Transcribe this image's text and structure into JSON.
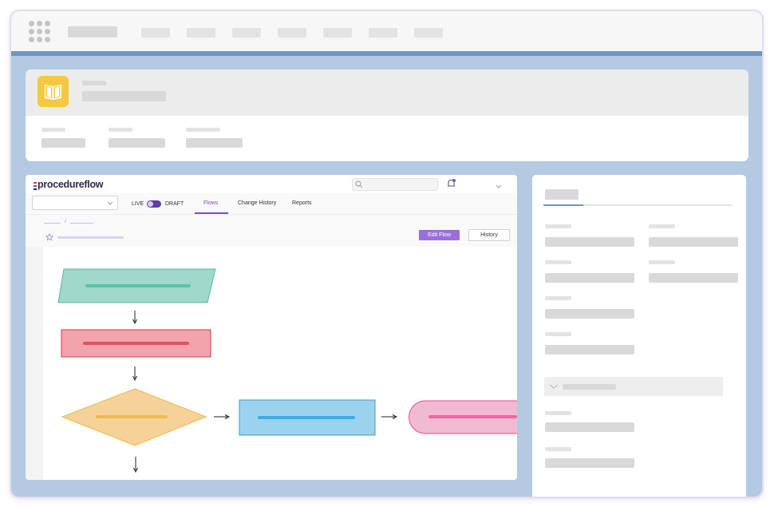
{
  "topbar": {
    "menu_icon": "grid-dots-icon",
    "accent_color": "#7096bd"
  },
  "header": {
    "icon": "book-open-icon",
    "icon_color": "#f5c842"
  },
  "procedureflow": {
    "logo_text": "procedureflow",
    "search_icon": "search-icon",
    "bell_icon": "bell-icon",
    "toggle": {
      "live_label": "LIVE",
      "draft_label": "DRAFT",
      "state": "DRAFT"
    },
    "tabs": [
      {
        "label": "Flows",
        "active": true
      },
      {
        "label": "Change History",
        "active": false
      },
      {
        "label": "Reports",
        "active": false
      }
    ],
    "breadcrumb_separator": "/",
    "star_icon": "star-icon",
    "edit_flow_label": "Edit Flow",
    "history_label": "History",
    "flow": {
      "nodes": [
        {
          "shape": "parallelogram",
          "fill": "#9ed9cb",
          "stroke": "#5bb8a2",
          "accent": "#5cc3a8"
        },
        {
          "shape": "rectangle",
          "fill": "#f2a3ab",
          "stroke": "#d9343f",
          "accent": "#e24f66"
        },
        {
          "shape": "diamond",
          "fill": "#f5d398",
          "stroke": "#ebb64b",
          "accent": "#f0bb55"
        },
        {
          "shape": "rectangle",
          "fill": "#9bd3ef",
          "stroke": "#3a9bd6",
          "accent": "#3aaee0"
        },
        {
          "shape": "terminator",
          "fill": "#f2bad2",
          "stroke": "#d9538e",
          "accent": "#e56aa2"
        }
      ],
      "arrow_icon": "arrow-icon"
    }
  },
  "side_panel": {
    "chevron_icon": "chevron-down-icon",
    "tab_accent": "#6f95c1"
  }
}
